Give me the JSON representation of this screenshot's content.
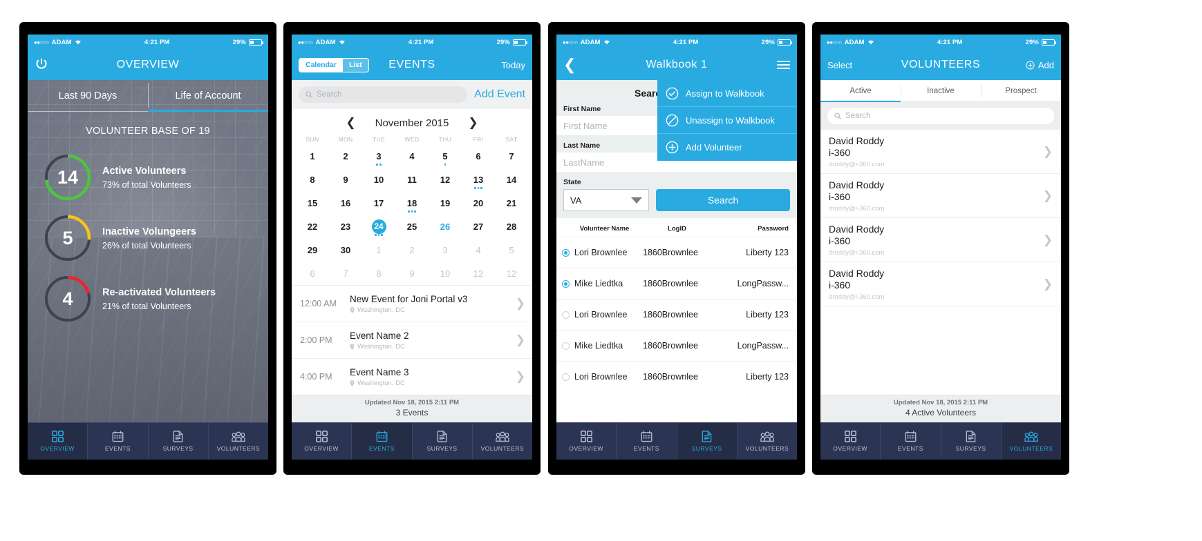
{
  "status_bar": {
    "carrier": "ADAM",
    "signal_dots": "●●○○○",
    "time": "4:21 PM",
    "battery": "29%"
  },
  "colors": {
    "brand_blue": "#29ABE2",
    "tabbar_bg": "#2b3452",
    "green": "#4cc63f",
    "yellow": "#f5c518",
    "red": "#e8262b"
  },
  "tabbar": {
    "items": [
      {
        "label": "OVERVIEW",
        "icon": "grid-icon"
      },
      {
        "label": "EVENTS",
        "icon": "calendar-icon"
      },
      {
        "label": "SURVEYS",
        "icon": "document-icon"
      },
      {
        "label": "VOLUNTEERS",
        "icon": "people-icon"
      }
    ]
  },
  "phone1": {
    "nav": {
      "title": "OVERVIEW",
      "power_icon": "power-icon"
    },
    "segment": {
      "left": "Last 90 Days",
      "right": "Life of Account",
      "selected": "Life of Account"
    },
    "headline": "VOLUNTEER BASE OF 19",
    "chart_data": {
      "type": "pie",
      "title": "VOLUNTEER BASE OF 19",
      "categories": [
        "Active Volunteers",
        "Inactive Volungeers",
        "Re-activated Volunteers"
      ],
      "values": [
        14,
        5,
        4
      ],
      "percents": [
        73,
        26,
        21
      ],
      "colors": [
        "#4cc63f",
        "#f5c518",
        "#e8262b"
      ],
      "total": 19,
      "legend": "inline"
    },
    "metrics": [
      {
        "count": "14",
        "title": "Active Volunteers",
        "sub": "73% of total Volunteers",
        "pct": 73,
        "color": "#4cc63f"
      },
      {
        "count": "5",
        "title": "Inactive Volungeers",
        "sub": "26% of total Volunteers",
        "pct": 26,
        "color": "#f5c518"
      },
      {
        "count": "4",
        "title": "Re-activated Volunteers",
        "sub": "21% of total Volunteers",
        "pct": 21,
        "color": "#e8262b"
      }
    ],
    "active_tab": "OVERVIEW"
  },
  "phone2": {
    "nav": {
      "title": "EVENTS",
      "segment_on": "Calendar",
      "segment_off": "List",
      "right": "Today"
    },
    "search": {
      "placeholder": "Search",
      "icon": "search-icon"
    },
    "add_event": "Add Event",
    "calendar": {
      "month": "November 2015",
      "prev_icon": "chevron-left-icon",
      "next_icon": "chevron-right-icon",
      "dow": [
        "SUN",
        "MON",
        "TUE",
        "WED",
        "THU",
        "FRI",
        "SAT"
      ],
      "weeks": [
        [
          {
            "d": "1"
          },
          {
            "d": "2"
          },
          {
            "d": "3",
            "dots": 2
          },
          {
            "d": "4"
          },
          {
            "d": "5",
            "dots": 1
          },
          {
            "d": "6"
          },
          {
            "d": "7"
          }
        ],
        [
          {
            "d": "8"
          },
          {
            "d": "9"
          },
          {
            "d": "10"
          },
          {
            "d": "11"
          },
          {
            "d": "12"
          },
          {
            "d": "13",
            "dots": 3
          },
          {
            "d": "14"
          }
        ],
        [
          {
            "d": "15"
          },
          {
            "d": "16"
          },
          {
            "d": "17"
          },
          {
            "d": "18",
            "dots": 3
          },
          {
            "d": "19"
          },
          {
            "d": "20"
          },
          {
            "d": "21"
          }
        ],
        [
          {
            "d": "22"
          },
          {
            "d": "23"
          },
          {
            "d": "24",
            "sel": true,
            "dots": 3
          },
          {
            "d": "25"
          },
          {
            "d": "26",
            "blue": true
          },
          {
            "d": "27"
          },
          {
            "d": "28"
          }
        ],
        [
          {
            "d": "29"
          },
          {
            "d": "30"
          },
          {
            "d": "1",
            "dim": true
          },
          {
            "d": "2",
            "dim": true
          },
          {
            "d": "3",
            "dim": true
          },
          {
            "d": "4",
            "dim": true
          },
          {
            "d": "5",
            "dim": true
          }
        ],
        [
          {
            "d": "6",
            "dim": true
          },
          {
            "d": "7",
            "dim": true
          },
          {
            "d": "8",
            "dim": true
          },
          {
            "d": "9",
            "dim": true
          },
          {
            "d": "10",
            "dim": true
          },
          {
            "d": "12",
            "dim": true
          },
          {
            "d": "12",
            "dim": true
          }
        ]
      ]
    },
    "events": [
      {
        "time": "12:00 AM",
        "name": "New Event for Joni Portal v3",
        "location": "Washington, DC"
      },
      {
        "time": "2:00 PM",
        "name": "Event Name 2",
        "location": "Washington, DC"
      },
      {
        "time": "4:00 PM",
        "name": "Event Name 3",
        "location": "Washington, DC"
      }
    ],
    "footer": {
      "updated": "Updated Nov 18, 2015 2:11 PM",
      "count": "3 Events"
    },
    "active_tab": "EVENTS"
  },
  "phone3": {
    "nav": {
      "title": "Walkbook 1",
      "back_icon": "chevron-left-icon",
      "menu_icon": "hamburger-icon"
    },
    "form_title": "Search Volunteers",
    "fields": {
      "first_name_label": "First Name",
      "first_name_placeholder": "First Name",
      "last_name_label": "Last Name",
      "last_name_placeholder": "LastName",
      "state_label": "State",
      "state_value": "VA",
      "search_button": "Search"
    },
    "dropdown": [
      {
        "label": "Assign to Walkbook",
        "icon": "check-circle-icon"
      },
      {
        "label": "Unassign to Walkbook",
        "icon": "ban-circle-icon"
      },
      {
        "label": "Add Volunteer",
        "icon": "plus-circle-icon"
      }
    ],
    "table_headers": {
      "name": "Volunteer Name",
      "logid": "LogID",
      "password": "Password"
    },
    "rows": [
      {
        "selected": true,
        "name": "Lori Brownlee",
        "logid": "1860Brownlee",
        "password": "Liberty 123"
      },
      {
        "selected": true,
        "name": "Mike Liedtka",
        "logid": "1860Brownlee",
        "password": "LongPassw..."
      },
      {
        "selected": false,
        "name": "Lori Brownlee",
        "logid": "1860Brownlee",
        "password": "Liberty 123"
      },
      {
        "selected": false,
        "name": "Mike Liedtka",
        "logid": "1860Brownlee",
        "password": "LongPassw..."
      },
      {
        "selected": false,
        "name": "Lori Brownlee",
        "logid": "1860Brownlee",
        "password": "Liberty 123"
      }
    ],
    "active_tab": "SURVEYS"
  },
  "phone4": {
    "nav": {
      "left": "Select",
      "title": "VOLUNTEERS",
      "right": "Add",
      "add_icon": "plus-circle-icon"
    },
    "tabs": [
      {
        "label": "Active",
        "on": true
      },
      {
        "label": "Inactive",
        "on": false
      },
      {
        "label": "Prospect",
        "on": false
      }
    ],
    "search": {
      "placeholder": "Search",
      "icon": "search-icon"
    },
    "people": [
      {
        "name": "David Roddy",
        "org": "i-360",
        "email": "droddy@i-360.com"
      },
      {
        "name": "David Roddy",
        "org": "i-360",
        "email": "droddy@i-360.com"
      },
      {
        "name": "David Roddy",
        "org": "i-360",
        "email": "droddy@i-360.com"
      },
      {
        "name": "David Roddy",
        "org": "i-360",
        "email": "droddy@i-360.com"
      }
    ],
    "footer": {
      "updated": "Updated Nov 18, 2015 2:11 PM",
      "count": "4 Active Volunteers"
    },
    "active_tab": "VOLUNTEERS"
  }
}
